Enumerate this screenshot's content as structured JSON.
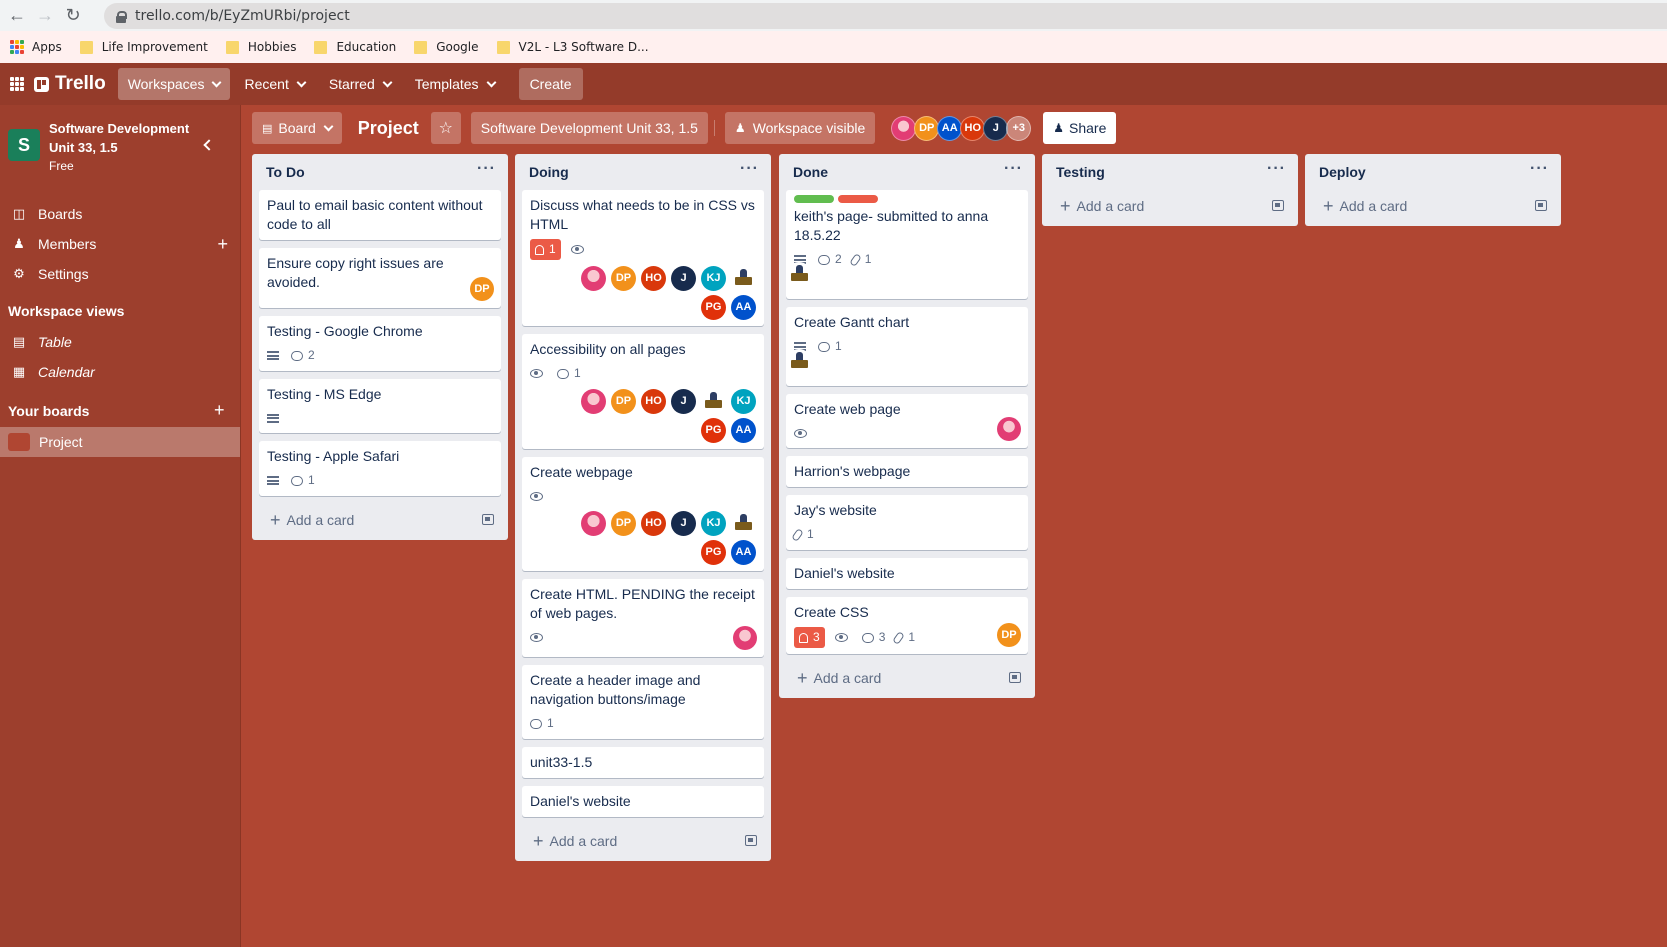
{
  "browser": {
    "url": "trello.com/b/EyZmURbi/project",
    "bookmarks": [
      "Apps",
      "Life Improvement",
      "Hobbies",
      "Education",
      "Google",
      "V2L - L3 Software D..."
    ]
  },
  "header": {
    "logo": "Trello",
    "menus": [
      "Workspaces",
      "Recent",
      "Starred",
      "Templates"
    ],
    "create": "Create"
  },
  "sidebar": {
    "workspace_initial": "S",
    "workspace_name": "Software Development Unit 33, 1.5",
    "workspace_plan": "Free",
    "nav": {
      "boards": "Boards",
      "members": "Members",
      "settings": "Settings"
    },
    "views_heading": "Workspace views",
    "views": {
      "table": "Table",
      "calendar": "Calendar"
    },
    "boards_heading": "Your boards",
    "board_item": "Project",
    "colors": {
      "board_swatch": "#b04632"
    }
  },
  "board": {
    "view_button": "Board",
    "title": "Project",
    "workspace_button": "Software Development Unit 33, 1.5",
    "visibility_button": "Workspace visible",
    "members": [
      "DP",
      "AA",
      "HO",
      "J"
    ],
    "extra_members": "+3",
    "share": "Share"
  },
  "lists": {
    "todo": {
      "title": "To Do",
      "add": "Add a card",
      "cards": [
        {
          "title": "Paul to email basic content without code to all"
        },
        {
          "title": "Ensure copy right issues are avoided.",
          "avatar": "DP"
        },
        {
          "title": "Testing - Google Chrome",
          "comments": "2"
        },
        {
          "title": "Testing - MS Edge"
        },
        {
          "title": "Testing - Apple Safari",
          "comments": "1"
        }
      ]
    },
    "doing": {
      "title": "Doing",
      "add": "Add a card",
      "cards": [
        {
          "title": "Discuss what needs to be in CSS vs HTML",
          "notifications": "1"
        },
        {
          "title": "Accessibility on all pages",
          "comments": "1"
        },
        {
          "title": "Create webpage"
        },
        {
          "title": "Create HTML. PENDING the receipt of web pages."
        },
        {
          "title": "Create a header image and navigation buttons/image",
          "comments": "1"
        },
        {
          "title": "unit33-1.5"
        },
        {
          "title": "Daniel's website"
        }
      ],
      "member_initials": [
        "DP",
        "HO",
        "J",
        "KJ",
        "PG",
        "AA"
      ]
    },
    "done": {
      "title": "Done",
      "add": "Add a card",
      "cards": [
        {
          "title": "keith's page- submitted to anna 18.5.22",
          "comments": "2",
          "attachments": "1"
        },
        {
          "title": "Create Gantt chart",
          "comments": "1"
        },
        {
          "title": "Create web page"
        },
        {
          "title": "Harrion's webpage"
        },
        {
          "title": "Jay's website",
          "attachments": "1"
        },
        {
          "title": "Daniel's website"
        },
        {
          "title": "Create CSS",
          "notifications": "3",
          "comments": "3",
          "attachments": "1",
          "avatar": "DP"
        }
      ]
    },
    "testing": {
      "title": "Testing",
      "add": "Add a card"
    },
    "deploy": {
      "title": "Deploy",
      "add": "Add a card"
    }
  },
  "colors": {
    "board_bg": "#b04632",
    "header_bg": "#943b2a",
    "sidebar_bg": "#9d3f2d",
    "list_bg": "#ebecf0",
    "label_green": "#61bd4f",
    "label_red": "#eb5a46",
    "avatar_DP": "#f2911b",
    "avatar_HO": "#d9380b",
    "avatar_J": "#172b4d",
    "avatar_KJ": "#00a3bf",
    "avatar_PG": "#e0310a",
    "avatar_AA": "#0052cc"
  }
}
